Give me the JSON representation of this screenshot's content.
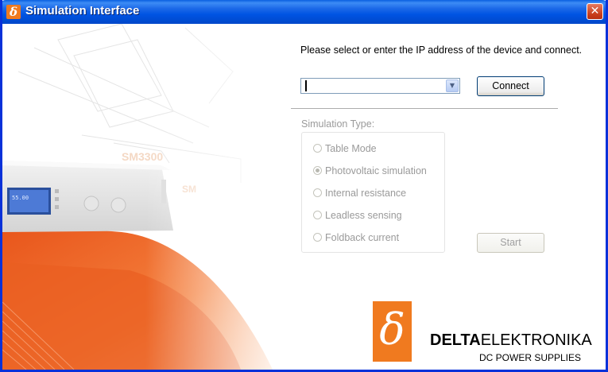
{
  "window": {
    "title": "Simulation Interface",
    "close_glyph": "✕",
    "app_icon_glyph": "δ"
  },
  "connection": {
    "prompt": "Please select or enter the IP address of the device and connect.",
    "ip_value": "",
    "dropdown_glyph": "▼",
    "connect_label": "Connect"
  },
  "simulation": {
    "type_label": "Simulation Type:",
    "options": [
      {
        "label": "Table Mode",
        "selected": false
      },
      {
        "label": "Photovoltaic simulation",
        "selected": true
      },
      {
        "label": "Internal resistance",
        "selected": false
      },
      {
        "label": "Leadless sensing",
        "selected": false
      },
      {
        "label": "Foldback current",
        "selected": false
      }
    ],
    "start_label": "Start",
    "enabled": false
  },
  "branding": {
    "logo_glyph": "δ",
    "name_bold": "DELTA",
    "name_rest": "ELEKTRONIKA",
    "tagline": "DC POWER SUPPLIES",
    "accent_color": "#f07a1f"
  },
  "colors": {
    "titlebar": "#0054e3",
    "orange": "#f07a1f",
    "disabled_text": "#9a9a9a"
  },
  "icons": [
    "delta-icon",
    "close-icon",
    "chevron-down-icon"
  ]
}
